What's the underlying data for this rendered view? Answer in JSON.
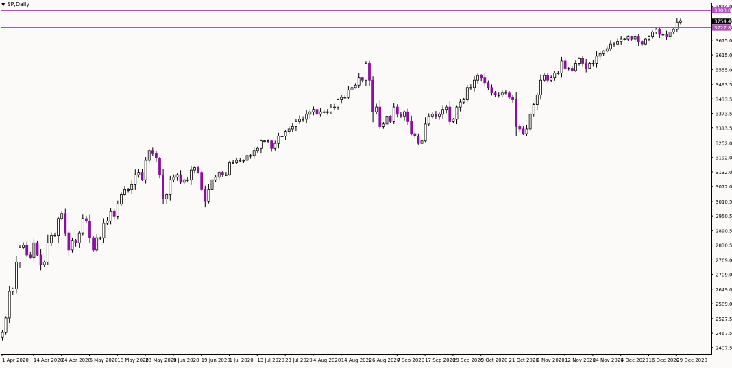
{
  "window": {
    "title": "SP,Daily"
  },
  "colors": {
    "background": "#fcf9f9",
    "bull_fill": "#ffffff",
    "bear_fill": "#8b0fa0",
    "wick": "#000000",
    "hline": "#b24fc6",
    "ask_line": "#a0a0a0",
    "price_tag": "#000000"
  },
  "chart_data": {
    "type": "candlestick",
    "symbol": "SP",
    "timeframe": "Daily",
    "ylim": [
      2380,
      3830
    ],
    "y_ticks": [
      "3814.0",
      "3754.4",
      "3727.8",
      "3675.0",
      "3615.0",
      "3555.0",
      "3493.5",
      "3433.5",
      "3373.5",
      "3313.5",
      "3252.0",
      "3192.0",
      "3132.0",
      "3072.0",
      "3010.5",
      "2950.5",
      "2890.5",
      "2830.5",
      "2769.0",
      "2709.0",
      "2649.0",
      "2589.0",
      "2527.5",
      "2467.5",
      "2407.5"
    ],
    "x_ticks": [
      {
        "label": "1 Apr 2020",
        "i": 0
      },
      {
        "label": "14 Apr 2020",
        "i": 9
      },
      {
        "label": "24 Apr 2020",
        "i": 17
      },
      {
        "label": "6 May 2020",
        "i": 25
      },
      {
        "label": "18 May 2020",
        "i": 33
      },
      {
        "label": "28 May 2020",
        "i": 41
      },
      {
        "label": "9 Jun 2020",
        "i": 49
      },
      {
        "label": "19 Jun 2020",
        "i": 57
      },
      {
        "label": "1 Jul 2020",
        "i": 65
      },
      {
        "label": "13 Jul 2020",
        "i": 73
      },
      {
        "label": "23 Jul 2020",
        "i": 81
      },
      {
        "label": "4 Aug 2020",
        "i": 89
      },
      {
        "label": "14 Aug 2020",
        "i": 97
      },
      {
        "label": "26 Aug 2020",
        "i": 105
      },
      {
        "label": "7 Sep 2020",
        "i": 113
      },
      {
        "label": "17 Sep 2020",
        "i": 121
      },
      {
        "label": "29 Sep 2020",
        "i": 129
      },
      {
        "label": "9 Oct 2020",
        "i": 137
      },
      {
        "label": "21 Oct 2020",
        "i": 145
      },
      {
        "label": "2 Nov 2020",
        "i": 153
      },
      {
        "label": "12 Nov 2020",
        "i": 161
      },
      {
        "label": "24 Nov 2020",
        "i": 169
      },
      {
        "label": "4 Dec 2020",
        "i": 177
      },
      {
        "label": "16 Dec 2020",
        "i": 185
      },
      {
        "label": "29 Dec 2020",
        "i": 193
      }
    ],
    "horizontal_lines": [
      {
        "price": 3800.0,
        "label": "3800.0",
        "color": "#b24fc6"
      },
      {
        "price": 3727.8,
        "label": "3727.8",
        "color": "#b24fc6"
      }
    ],
    "ask_line": {
      "price": 3764.0
    },
    "current_price": {
      "price": 3754.4,
      "label": "3754.4"
    },
    "closes": [
      2470,
      2530,
      2640,
      2650,
      2760,
      2820,
      2830,
      2790,
      2780,
      2840,
      2790,
      2750,
      2760,
      2840,
      2870,
      2870,
      2940,
      2960,
      2880,
      2810,
      2850,
      2840,
      2880,
      2940,
      2930,
      2860,
      2810,
      2860,
      2860,
      2920,
      2930,
      2970,
      2950,
      3000,
      3040,
      3060,
      3060,
      3080,
      3120,
      3130,
      3100,
      3180,
      3220,
      3210,
      3190,
      3120,
      3020,
      3040,
      3100,
      3110,
      3120,
      3090,
      3100,
      3100,
      3140,
      3150,
      3130,
      3060,
      3010,
      3060,
      3100,
      3110,
      3130,
      3120,
      3120,
      3170,
      3170,
      3180,
      3180,
      3180,
      3200,
      3200,
      3220,
      3230,
      3260,
      3260,
      3260,
      3230,
      3250,
      3280,
      3280,
      3300,
      3310,
      3320,
      3340,
      3350,
      3350,
      3370,
      3380,
      3390,
      3370,
      3380,
      3380,
      3380,
      3400,
      3400,
      3430,
      3440,
      3440,
      3470,
      3480,
      3490,
      3520,
      3510,
      3580,
      3510,
      3380,
      3400,
      3320,
      3330,
      3360,
      3340,
      3400,
      3370,
      3360,
      3380,
      3340,
      3290,
      3280,
      3250,
      3260,
      3330,
      3360,
      3370,
      3360,
      3370,
      3390,
      3400,
      3340,
      3350,
      3400,
      3420,
      3430,
      3480,
      3480,
      3510,
      3530,
      3520,
      3500,
      3480,
      3460,
      3450,
      3450,
      3460,
      3460,
      3440,
      3430,
      3320,
      3310,
      3290,
      3310,
      3370,
      3410,
      3450,
      3510,
      3530,
      3510,
      3520,
      3540,
      3540,
      3590,
      3560,
      3560,
      3550,
      3580,
      3600,
      3580,
      3560,
      3580,
      3580,
      3610,
      3620,
      3630,
      3640,
      3660,
      3660,
      3670,
      3680,
      3680,
      3690,
      3680,
      3690,
      3670,
      3660,
      3680,
      3690,
      3710,
      3720,
      3700,
      3700,
      3690,
      3710,
      3720,
      3750,
      3756
    ]
  }
}
